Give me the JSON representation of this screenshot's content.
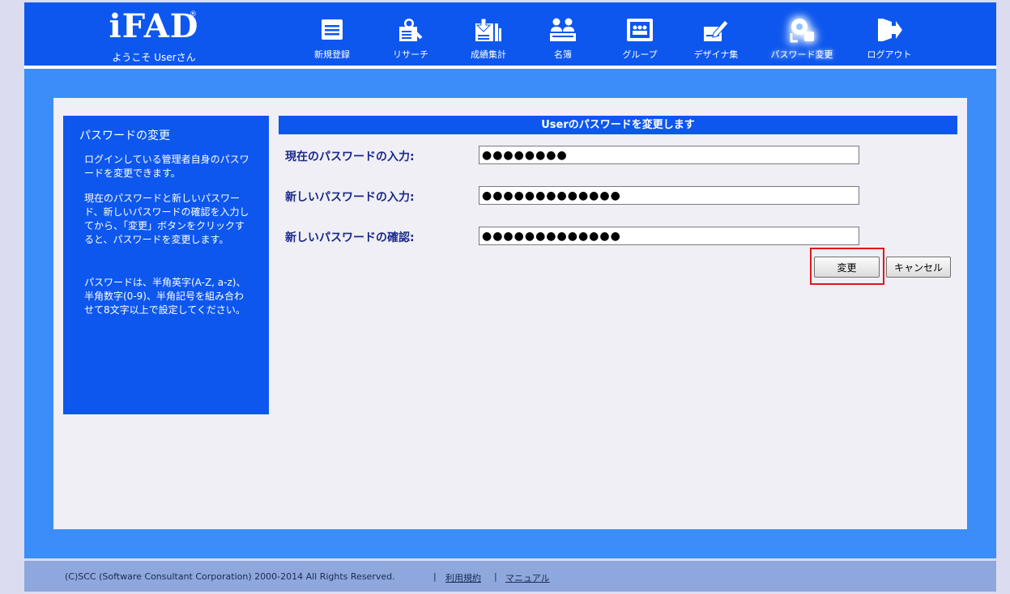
{
  "header": {
    "logo": "iFAD",
    "logo_mark": "®",
    "welcome": "ようこそ Userさん",
    "nav": [
      {
        "label": "新規登録",
        "icon": "document-icon"
      },
      {
        "label": "リサーチ",
        "icon": "research-icon"
      },
      {
        "label": "成績集計",
        "icon": "score-tally-icon"
      },
      {
        "label": "名簿",
        "icon": "roster-people-icon"
      },
      {
        "label": "グループ",
        "icon": "group-icon"
      },
      {
        "label": "デザイナ集",
        "icon": "designer-pen-icon"
      },
      {
        "label": "パスワード変更",
        "icon": "password-key-icon",
        "active": true
      },
      {
        "label": "ログアウト",
        "icon": "logout-icon"
      }
    ]
  },
  "sidebar": {
    "title": "パスワードの変更",
    "paragraphs": [
      "ログインしている管理者自身のパスワードを変更できます。",
      "現在のパスワードと新しいパスワード、新しいパスワードの確認を入力してから、「変更」ボタンをクリックすると、パスワードを変更します。",
      "パスワードは、半角英字(A-Z, a-z)、半角数字(0-9)、半角記号を組み合わせて8文字以上で設定してください。"
    ]
  },
  "form": {
    "header": "Userのパスワードを変更します",
    "fields": [
      {
        "label": "現在のパスワードの入力:",
        "value": "●●●●●●●●"
      },
      {
        "label": "新しいパスワードの入力:",
        "value": "●●●●●●●●●●●●●"
      },
      {
        "label": "新しいパスワードの確認:",
        "value": "●●●●●●●●●●●●●"
      }
    ],
    "submit_label": "変更",
    "cancel_label": "キャンセル"
  },
  "footer": {
    "copyright": "(C)SCC (Software Consultant Corporation) 2000-2014 All Rights Reserved.",
    "separator": "|",
    "terms_link": "利用規約",
    "manual_link": "マニュアル"
  },
  "colors": {
    "header_bg": "#0d57ee",
    "main_bg": "#3b8df9",
    "content_bg": "#f0eff5",
    "footer_bg": "#8ea7dc",
    "highlight": "#e3161d"
  }
}
